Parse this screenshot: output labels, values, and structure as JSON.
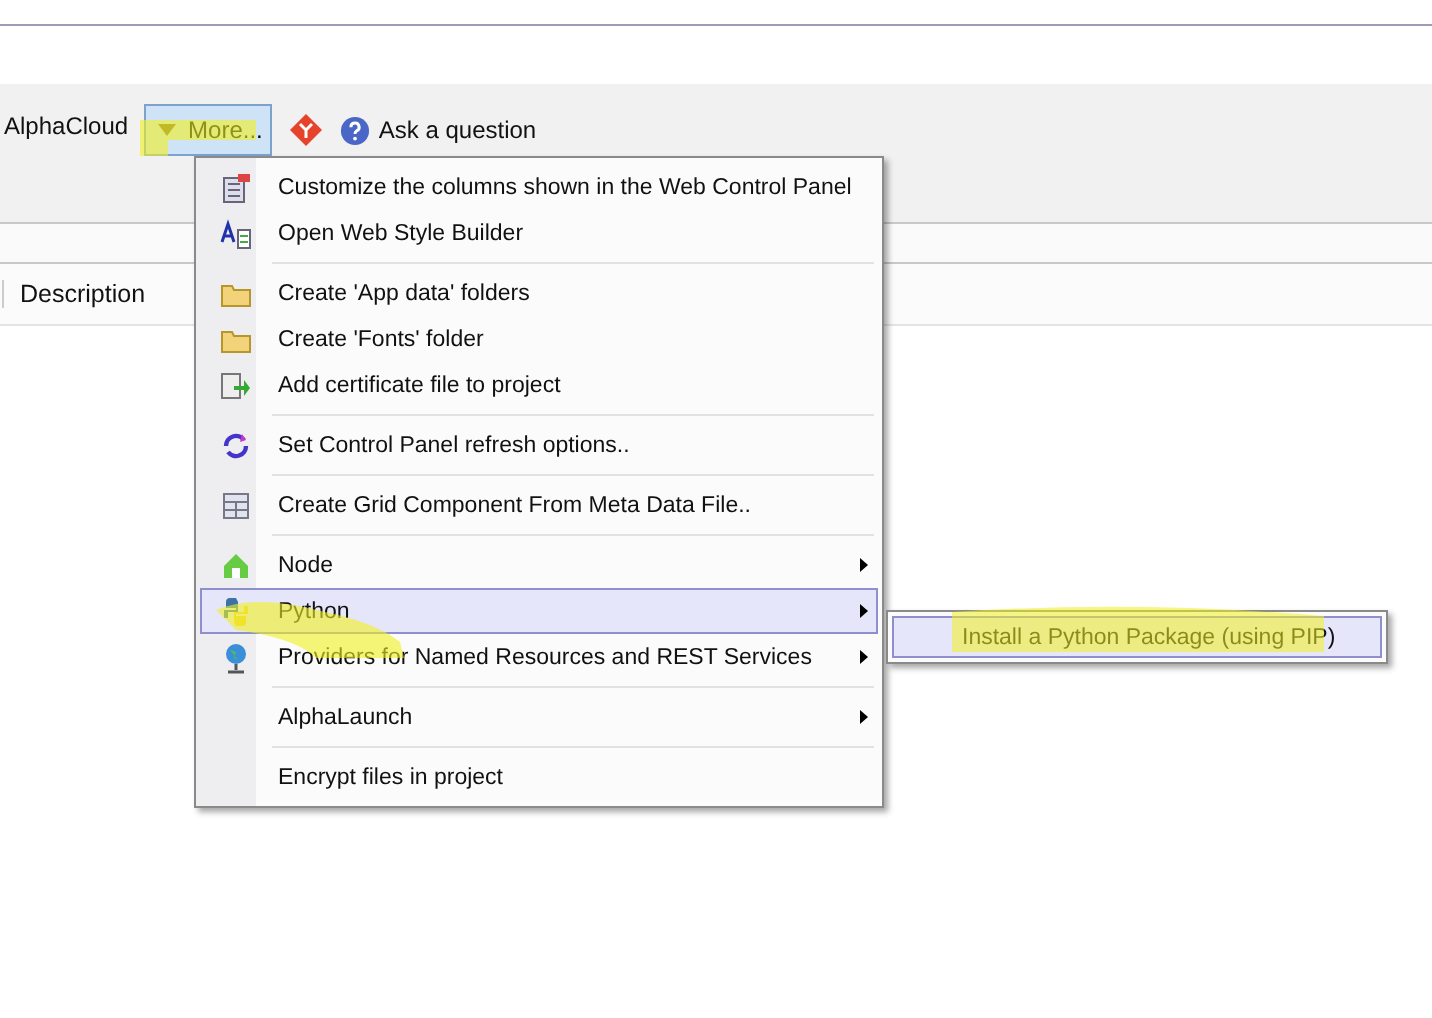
{
  "toolbar": {
    "label": "AlphaCloud",
    "more_button": {
      "label": "More...",
      "expanded": true
    },
    "help_link": "Ask a question"
  },
  "table": {
    "columns": [
      "Description"
    ]
  },
  "menu": {
    "groups": [
      {
        "items": [
          {
            "kind": "columns",
            "label": "Customize the columns shown in the Web Control Panel",
            "has_submenu": false,
            "selected": false
          },
          {
            "kind": "style",
            "label": "Open Web Style Builder",
            "has_submenu": false,
            "selected": false
          }
        ]
      },
      {
        "items": [
          {
            "kind": "folder",
            "label": "Create 'App data' folders",
            "has_submenu": false,
            "selected": false
          },
          {
            "kind": "folder",
            "label": "Create 'Fonts' folder",
            "has_submenu": false,
            "selected": false
          },
          {
            "kind": "certificate",
            "label": "Add certificate file to project",
            "has_submenu": false,
            "selected": false
          }
        ]
      },
      {
        "items": [
          {
            "kind": "refresh",
            "label": "Set Control Panel refresh options..",
            "has_submenu": false,
            "selected": false
          }
        ]
      },
      {
        "items": [
          {
            "kind": "grid",
            "label": "Create Grid Component From Meta Data File..",
            "has_submenu": false,
            "selected": false
          }
        ]
      },
      {
        "items": [
          {
            "kind": "node",
            "label": "Node",
            "has_submenu": true,
            "selected": false
          },
          {
            "kind": "python",
            "label": "Python",
            "has_submenu": true,
            "selected": true
          },
          {
            "kind": "globe",
            "label": "Providers for Named Resources and REST Services",
            "has_submenu": true,
            "selected": false
          }
        ]
      },
      {
        "items": [
          {
            "kind": "none",
            "label": "AlphaLaunch",
            "has_submenu": true,
            "selected": false
          }
        ]
      },
      {
        "items": [
          {
            "kind": "none",
            "label": "Encrypt files in project",
            "has_submenu": false,
            "selected": false
          }
        ]
      }
    ]
  },
  "submenu": {
    "items": [
      {
        "label": "Install a Python Package (using PIP)",
        "selected": true
      }
    ]
  }
}
